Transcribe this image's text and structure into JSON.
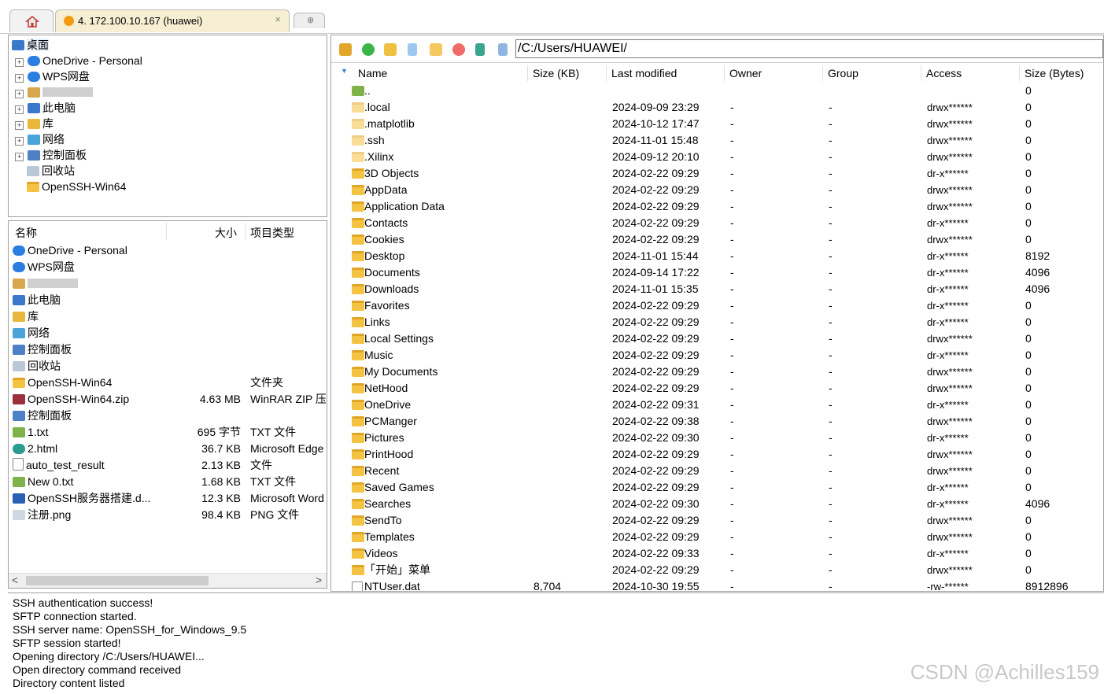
{
  "tabs": {
    "home_icon": "home-icon",
    "session_label": "4. 172.100.10.167 (huawei)",
    "close_label": "×",
    "new_tab_icon": "new-tab-icon"
  },
  "tree": {
    "items": [
      {
        "label": "桌面",
        "icon": "desktop-icon"
      },
      {
        "label": "OneDrive - Personal",
        "icon": "onedrive-icon"
      },
      {
        "label": "WPS网盘",
        "icon": "wps-cloud-icon"
      },
      {
        "label": "",
        "icon": "user-folder-icon"
      },
      {
        "label": "此电脑",
        "icon": "pc-icon"
      },
      {
        "label": "库",
        "icon": "library-icon"
      },
      {
        "label": "网络",
        "icon": "network-icon"
      },
      {
        "label": "控制面板",
        "icon": "control-panel-icon"
      },
      {
        "label": "回收站",
        "icon": "recycle-bin-icon"
      },
      {
        "label": "OpenSSH-Win64",
        "icon": "folder-icon"
      }
    ]
  },
  "local": {
    "columns": {
      "name": "名称",
      "size": "大小",
      "type": "项目类型"
    },
    "rows": [
      {
        "name": "OneDrive - Personal",
        "size": "",
        "type": ""
      },
      {
        "name": "WPS网盘",
        "size": "",
        "type": ""
      },
      {
        "name": "",
        "size": "",
        "type": ""
      },
      {
        "name": "此电脑",
        "size": "",
        "type": ""
      },
      {
        "name": "库",
        "size": "",
        "type": ""
      },
      {
        "name": "网络",
        "size": "",
        "type": ""
      },
      {
        "name": "控制面板",
        "size": "",
        "type": ""
      },
      {
        "name": "回收站",
        "size": "",
        "type": ""
      },
      {
        "name": "OpenSSH-Win64",
        "size": "",
        "type": "文件夹"
      },
      {
        "name": "OpenSSH-Win64.zip",
        "size": "4.63 MB",
        "type": "WinRAR ZIP 压"
      },
      {
        "name": "控制面板",
        "size": "",
        "type": ""
      },
      {
        "name": "1.txt",
        "size": "695 字节",
        "type": "TXT 文件"
      },
      {
        "name": "2.html",
        "size": "36.7 KB",
        "type": "Microsoft Edge"
      },
      {
        "name": "auto_test_result",
        "size": "2.13 KB",
        "type": "文件"
      },
      {
        "name": "New 0.txt",
        "size": "1.68 KB",
        "type": "TXT 文件"
      },
      {
        "name": "OpenSSH服务器搭建.d...",
        "size": "12.3 KB",
        "type": "Microsoft Word"
      },
      {
        "name": "注册.png",
        "size": "98.4 KB",
        "type": "PNG 文件"
      }
    ],
    "scroll_left": "<",
    "scroll_right": ">"
  },
  "remote": {
    "path": "/C:/Users/HUAWEI/",
    "columns": {
      "name": "Name",
      "size": "Size (KB)",
      "modified": "Last modified",
      "owner": "Owner",
      "group": "Group",
      "access": "Access",
      "bytes": "Size (Bytes)"
    },
    "rows": [
      {
        "name": "..",
        "size": "",
        "modified": "",
        "owner": "",
        "group": "",
        "access": "",
        "bytes": "0"
      },
      {
        "name": ".local",
        "size": "",
        "modified": "2024-09-09 23:29",
        "owner": "-",
        "group": "-",
        "access": "drwx******",
        "bytes": "0"
      },
      {
        "name": ".matplotlib",
        "size": "",
        "modified": "2024-10-12 17:47",
        "owner": "-",
        "group": "-",
        "access": "drwx******",
        "bytes": "0"
      },
      {
        "name": ".ssh",
        "size": "",
        "modified": "2024-11-01 15:48",
        "owner": "-",
        "group": "-",
        "access": "drwx******",
        "bytes": "0"
      },
      {
        "name": ".Xilinx",
        "size": "",
        "modified": "2024-09-12 20:10",
        "owner": "-",
        "group": "-",
        "access": "drwx******",
        "bytes": "0"
      },
      {
        "name": "3D Objects",
        "size": "",
        "modified": "2024-02-22 09:29",
        "owner": "-",
        "group": "-",
        "access": "dr-x******",
        "bytes": "0"
      },
      {
        "name": "AppData",
        "size": "",
        "modified": "2024-02-22 09:29",
        "owner": "-",
        "group": "-",
        "access": "drwx******",
        "bytes": "0"
      },
      {
        "name": "Application Data",
        "size": "",
        "modified": "2024-02-22 09:29",
        "owner": "-",
        "group": "-",
        "access": "drwx******",
        "bytes": "0"
      },
      {
        "name": "Contacts",
        "size": "",
        "modified": "2024-02-22 09:29",
        "owner": "-",
        "group": "-",
        "access": "dr-x******",
        "bytes": "0"
      },
      {
        "name": "Cookies",
        "size": "",
        "modified": "2024-02-22 09:29",
        "owner": "-",
        "group": "-",
        "access": "drwx******",
        "bytes": "0"
      },
      {
        "name": "Desktop",
        "size": "",
        "modified": "2024-11-01 15:44",
        "owner": "-",
        "group": "-",
        "access": "dr-x******",
        "bytes": "8192"
      },
      {
        "name": "Documents",
        "size": "",
        "modified": "2024-09-14 17:22",
        "owner": "-",
        "group": "-",
        "access": "dr-x******",
        "bytes": "4096"
      },
      {
        "name": "Downloads",
        "size": "",
        "modified": "2024-11-01 15:35",
        "owner": "-",
        "group": "-",
        "access": "dr-x******",
        "bytes": "4096"
      },
      {
        "name": "Favorites",
        "size": "",
        "modified": "2024-02-22 09:29",
        "owner": "-",
        "group": "-",
        "access": "dr-x******",
        "bytes": "0"
      },
      {
        "name": "Links",
        "size": "",
        "modified": "2024-02-22 09:29",
        "owner": "-",
        "group": "-",
        "access": "dr-x******",
        "bytes": "0"
      },
      {
        "name": "Local Settings",
        "size": "",
        "modified": "2024-02-22 09:29",
        "owner": "-",
        "group": "-",
        "access": "drwx******",
        "bytes": "0"
      },
      {
        "name": "Music",
        "size": "",
        "modified": "2024-02-22 09:29",
        "owner": "-",
        "group": "-",
        "access": "dr-x******",
        "bytes": "0"
      },
      {
        "name": "My Documents",
        "size": "",
        "modified": "2024-02-22 09:29",
        "owner": "-",
        "group": "-",
        "access": "drwx******",
        "bytes": "0"
      },
      {
        "name": "NetHood",
        "size": "",
        "modified": "2024-02-22 09:29",
        "owner": "-",
        "group": "-",
        "access": "drwx******",
        "bytes": "0"
      },
      {
        "name": "OneDrive",
        "size": "",
        "modified": "2024-02-22 09:31",
        "owner": "-",
        "group": "-",
        "access": "dr-x******",
        "bytes": "0"
      },
      {
        "name": "PCManger",
        "size": "",
        "modified": "2024-02-22 09:38",
        "owner": "-",
        "group": "-",
        "access": "drwx******",
        "bytes": "0"
      },
      {
        "name": "Pictures",
        "size": "",
        "modified": "2024-02-22 09:30",
        "owner": "-",
        "group": "-",
        "access": "dr-x******",
        "bytes": "0"
      },
      {
        "name": "PrintHood",
        "size": "",
        "modified": "2024-02-22 09:29",
        "owner": "-",
        "group": "-",
        "access": "drwx******",
        "bytes": "0"
      },
      {
        "name": "Recent",
        "size": "",
        "modified": "2024-02-22 09:29",
        "owner": "-",
        "group": "-",
        "access": "drwx******",
        "bytes": "0"
      },
      {
        "name": "Saved Games",
        "size": "",
        "modified": "2024-02-22 09:29",
        "owner": "-",
        "group": "-",
        "access": "dr-x******",
        "bytes": "0"
      },
      {
        "name": "Searches",
        "size": "",
        "modified": "2024-02-22 09:30",
        "owner": "-",
        "group": "-",
        "access": "dr-x******",
        "bytes": "4096"
      },
      {
        "name": "SendTo",
        "size": "",
        "modified": "2024-02-22 09:29",
        "owner": "-",
        "group": "-",
        "access": "drwx******",
        "bytes": "0"
      },
      {
        "name": "Templates",
        "size": "",
        "modified": "2024-02-22 09:29",
        "owner": "-",
        "group": "-",
        "access": "drwx******",
        "bytes": "0"
      },
      {
        "name": "Videos",
        "size": "",
        "modified": "2024-02-22 09:33",
        "owner": "-",
        "group": "-",
        "access": "dr-x******",
        "bytes": "0"
      },
      {
        "name": "「开始」菜单",
        "size": "",
        "modified": "2024-02-22 09:29",
        "owner": "-",
        "group": "-",
        "access": "drwx******",
        "bytes": "0"
      },
      {
        "name": "NTUser.dat",
        "size": "8,704",
        "modified": "2024-10-30 19:55",
        "owner": "-",
        "group": "-",
        "access": "-rw-******",
        "bytes": "8912896"
      }
    ]
  },
  "log": {
    "lines": [
      "SSH authentication success!",
      "SFTP connection started.",
      "SSH server name: OpenSSH_for_Windows_9.5",
      "SFTP session started!",
      "Opening directory /C:/Users/HUAWEI...",
      "Open directory command received",
      "Directory content listed"
    ]
  },
  "watermark": "CSDN @Achilles159",
  "colors": {
    "session_tab_bg": "#f7efd3",
    "folder": "#f5c342",
    "border": "#a0a0a0"
  }
}
